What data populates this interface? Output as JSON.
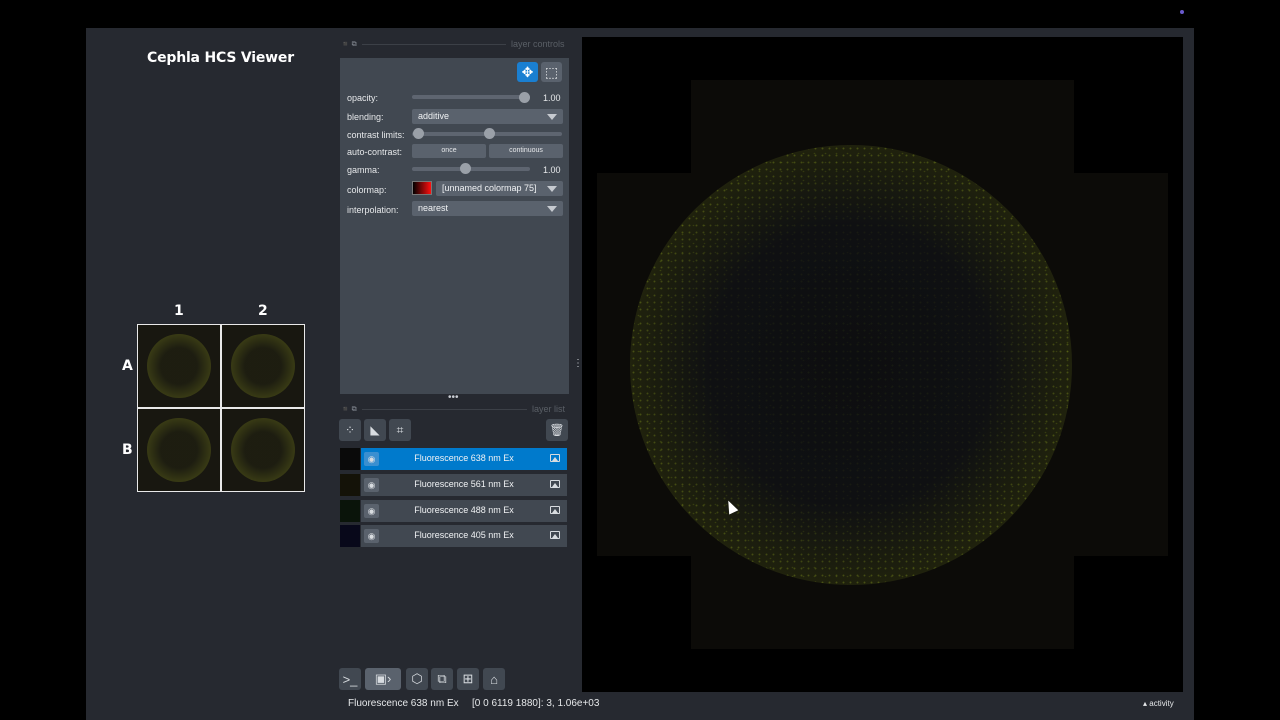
{
  "app": {
    "title": "Cephla HCS Viewer"
  },
  "plate": {
    "columns": [
      "1",
      "2"
    ],
    "rows": [
      "A",
      "B"
    ]
  },
  "layer_controls": {
    "dock_title": "layer controls",
    "opacity": {
      "label": "opacity:",
      "value": "1.00",
      "fraction": 1.0
    },
    "blending": {
      "label": "blending:",
      "value": "additive"
    },
    "contrast_limits": {
      "label": "contrast limits:"
    },
    "auto_contrast": {
      "label": "auto-contrast:",
      "once": "once",
      "continuous": "continuous"
    },
    "gamma": {
      "label": "gamma:",
      "value": "1.00",
      "fraction": 0.45
    },
    "colormap": {
      "label": "colormap:",
      "value": "[unnamed colormap 75]"
    },
    "interpolation": {
      "label": "interpolation:",
      "value": "nearest"
    }
  },
  "layer_list": {
    "dock_title": "layer list",
    "layers": [
      {
        "name": "Fluorescence 638 nm Ex",
        "selected": true,
        "thumb_color": "#0a0a0a"
      },
      {
        "name": "Fluorescence 561 nm Ex",
        "selected": false,
        "thumb_color": "#141208"
      },
      {
        "name": "Fluorescence 488 nm Ex",
        "selected": false,
        "thumb_color": "#0a140a"
      },
      {
        "name": "Fluorescence 405 nm Ex",
        "selected": false,
        "thumb_color": "#08081a"
      }
    ]
  },
  "status": {
    "layer": "Fluorescence 638 nm Ex",
    "coords": "[0 0 6119 1880]: 3, 1.06e+03",
    "activity": "▴ activity"
  },
  "colors": {
    "window_bg": "#262930",
    "panel_bg": "#414851",
    "selected": "#007acc",
    "accent_button": "#1a7fd1"
  },
  "icons": {
    "toolbar": [
      "pan-zoom-icon",
      "transform-icon"
    ],
    "layer_tools": [
      "points-layer-icon",
      "shapes-layer-icon",
      "labels-layer-icon",
      "delete-layer-icon"
    ],
    "bottom": [
      "console-icon",
      "2d-3d-toggle-icon",
      "roll-icon",
      "transpose-icon",
      "grid-icon",
      "home-icon"
    ]
  }
}
